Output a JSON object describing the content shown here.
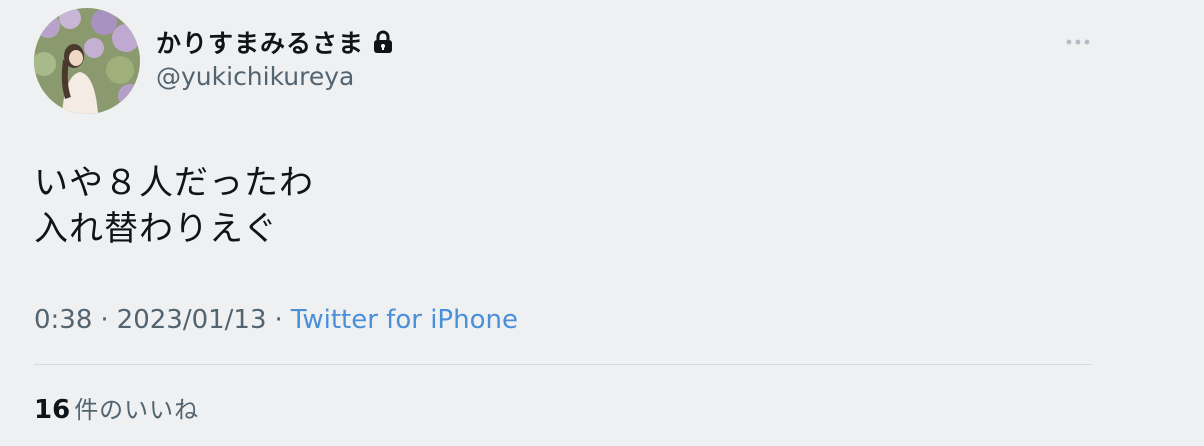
{
  "author": {
    "display_name": "かりすまみるさま",
    "handle": "@yukichikureya",
    "avatar_icon": "avatar-photo",
    "protected_icon": "lock-icon"
  },
  "tweet": {
    "lines": [
      "いや８人だったわ",
      "入れ替わりえぐ"
    ]
  },
  "meta": {
    "time": "0:38",
    "separator": "·",
    "date": "2023/01/13",
    "source": "Twitter for iPhone"
  },
  "stats": {
    "likes_count": "16",
    "likes_label": "件のいいね"
  },
  "colors": {
    "background": "#eef0f2",
    "text_primary": "#0f1419",
    "text_secondary": "#536471",
    "link": "#4a90d9",
    "divider": "#d6dbe0"
  }
}
